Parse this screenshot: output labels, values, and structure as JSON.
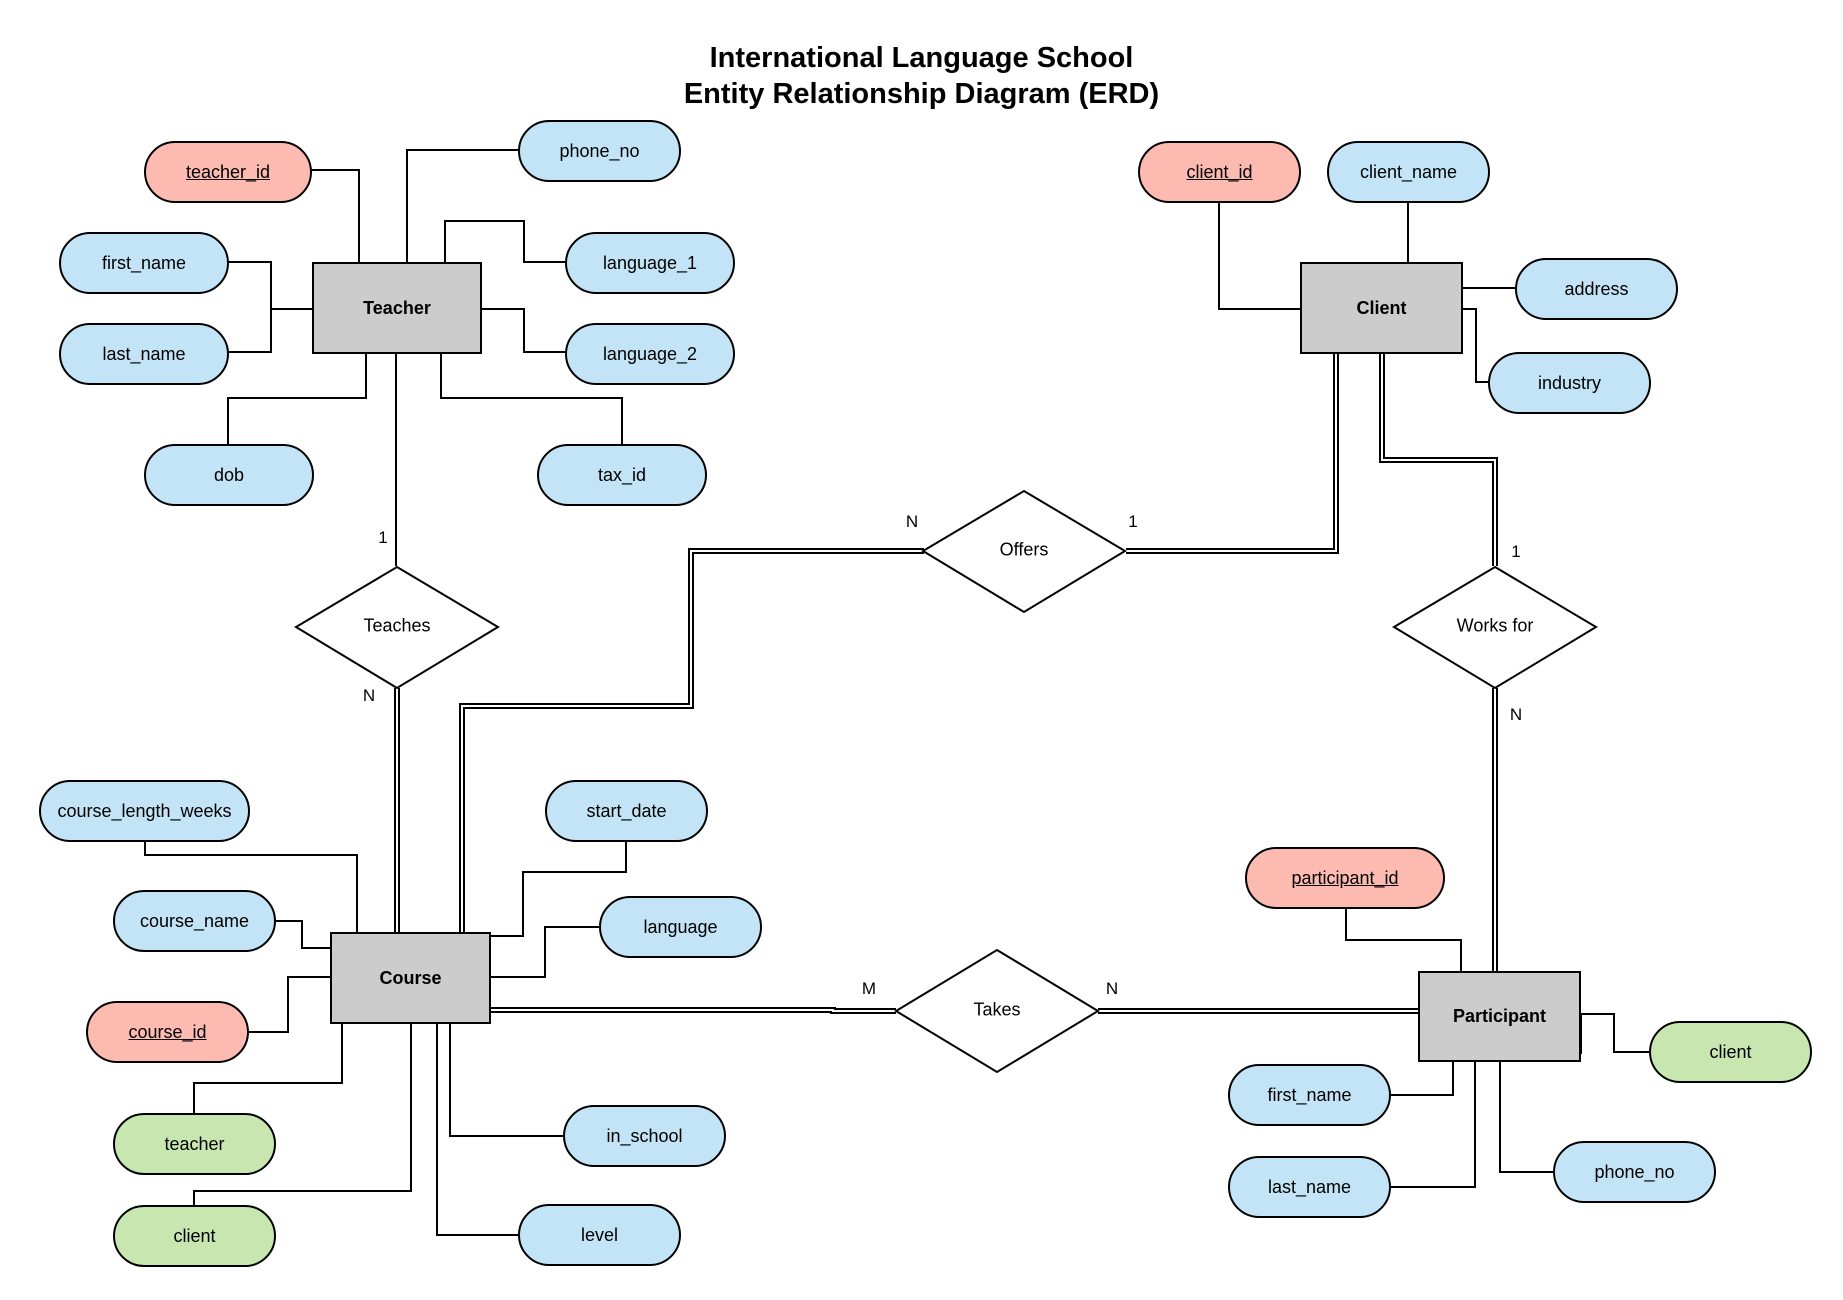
{
  "title": {
    "line1": "International Language School",
    "line2": "Entity Relationship Diagram (ERD)"
  },
  "colors": {
    "entity_fill": "#cccccc",
    "attribute_fill": "#c3e4f6",
    "primary_key_fill": "#fdbab0",
    "foreign_key_fill": "#c8e6b0",
    "line": "#000000"
  },
  "entities": {
    "teacher": {
      "label": "Teacher",
      "attributes": {
        "teacher_id": "teacher_id",
        "phone_no": "phone_no",
        "first_name": "first_name",
        "last_name": "last_name",
        "language_1": "language_1",
        "language_2": "language_2",
        "dob": "dob",
        "tax_id": "tax_id"
      }
    },
    "client": {
      "label": "Client",
      "attributes": {
        "client_id": "client_id",
        "client_name": "client_name",
        "address": "address",
        "industry": "industry"
      }
    },
    "course": {
      "label": "Course",
      "attributes": {
        "course_length_weeks": "course_length_weeks",
        "course_name": "course_name",
        "course_id": "course_id",
        "teacher": "teacher",
        "client": "client",
        "start_date": "start_date",
        "language": "language",
        "in_school": "in_school",
        "level": "level"
      }
    },
    "participant": {
      "label": "Participant",
      "attributes": {
        "participant_id": "participant_id",
        "client": "client",
        "first_name": "first_name",
        "last_name": "last_name",
        "phone_no": "phone_no"
      }
    }
  },
  "relationships": {
    "teaches": {
      "label": "Teaches",
      "card_top": "1",
      "card_bottom": "N"
    },
    "offers": {
      "label": "Offers",
      "card_left": "N",
      "card_right": "1"
    },
    "works_for": {
      "label": "Works for",
      "card_top": "1",
      "card_bottom": "N"
    },
    "takes": {
      "label": "Takes",
      "card_left": "M",
      "card_right": "N"
    }
  }
}
